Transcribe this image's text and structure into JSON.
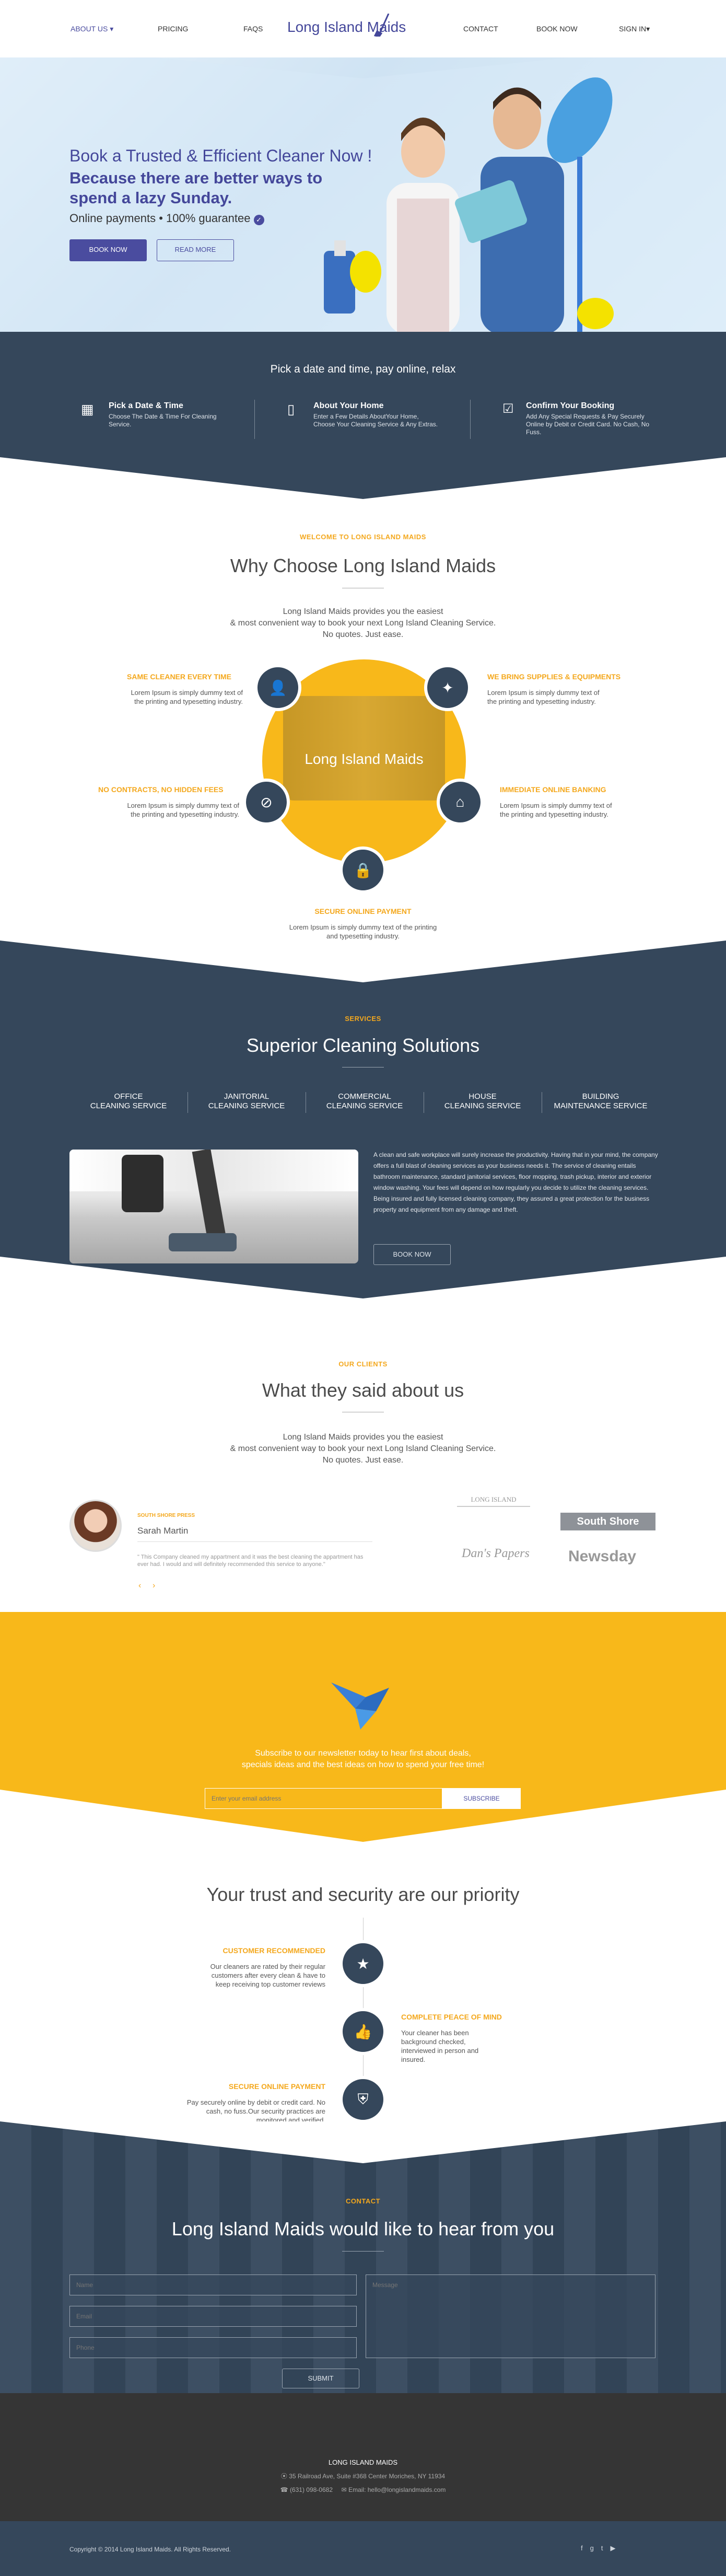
{
  "nav": {
    "about": "ABOUT US",
    "pricing": "PRICING",
    "faqs": "FAQS",
    "logo": "Long Island Maids",
    "contact": "CONTACT",
    "book": "BOOK NOW",
    "signin": "SIGN IN"
  },
  "hero": {
    "line1": "Book a Trusted & Efficient Cleaner Now !",
    "line2": "Because there are better ways to spend a lazy Sunday.",
    "line3": "Online payments • 100% guarantee",
    "book_btn": "BOOK NOW",
    "read_btn": "READ MORE"
  },
  "steps": {
    "heading": "Pick a date and time, pay online, relax",
    "items": [
      {
        "title": "Pick a Date & Time",
        "text": "Choose The Date & Time For Cleaning Service."
      },
      {
        "title": "About Your Home",
        "text": "Enter a Few Details AboutYour Home, Choose Your Cleaning Service & Any Extras."
      },
      {
        "title": "Confirm Your Booking",
        "text": "Add Any Special Requests & Pay Securely Online by Debit or Credit Card. No Cash, No Fuss."
      }
    ]
  },
  "why": {
    "label": "WELCOME TO LONG ISLAND MAIDS",
    "title": "Why Choose Long Island Maids",
    "sub1": "Long Island Maids provides you the easiest",
    "sub2": "& most convenient way to book your next Long Island Cleaning Service.",
    "sub3": "No quotes. Just ease.",
    "center_logo": "Long Island Maids",
    "features": [
      {
        "title": "SAME CLEANER EVERY TIME",
        "text": "Lorem Ipsum is simply dummy text of the printing and typesetting industry."
      },
      {
        "title": "WE BRING SUPPLIES & EQUIPMENTS",
        "text": "Lorem Ipsum is simply dummy text of the printing and typesetting industry."
      },
      {
        "title": "NO CONTRACTS, NO HIDDEN FEES",
        "text": "Lorem Ipsum is simply dummy text of the printing and typesetting industry."
      },
      {
        "title": "IMMEDIATE ONLINE BANKING",
        "text": "Lorem Ipsum is simply dummy text of the printing and typesetting industry."
      },
      {
        "title": "SECURE ONLINE PAYMENT",
        "text": "Lorem Ipsum is simply dummy text of the printing and typesetting industry."
      }
    ]
  },
  "services": {
    "label": "SERVICES",
    "title": "Superior Cleaning Solutions",
    "tabs": [
      [
        "OFFICE",
        "CLEANING SERVICE"
      ],
      [
        "JANITORIAL",
        "CLEANING SERVICE"
      ],
      [
        "COMMERCIAL",
        "CLEANING SERVICE"
      ],
      [
        "HOUSE",
        "CLEANING SERVICE"
      ],
      [
        "BUILDING",
        "MAINTENANCE SERVICE"
      ]
    ],
    "text": "A clean and safe workplace will surely increase the productivity. Having that in your mind, the company offers a full blast of cleaning services as your business needs it. The service of cleaning entails bathroom maintenance, standard janitorial services, floor mopping, trash pickup, interior and exterior window washing. Your fees will depend on how regularly you decide to utilize the cleaning services. Being insured and fully licensed cleaning company, they assured a great protection for the business property and equipment from any damage and theft.",
    "btn": "BOOK NOW"
  },
  "clients": {
    "label": "OUR CLIENTS",
    "title": "What they said about us",
    "sub1": "Long Island Maids provides you the easiest",
    "sub2": "& most convenient way to book your next Long Island Cleaning Service.",
    "sub3": "No quotes. Just ease.",
    "source": "SOUTH SHORE PRESS",
    "name": "Sarah Martin",
    "quote": "\" This Company cleaned my appartment and it was the best cleaning the appartment has ever had. I would and will definitely recommended this service to anyone.\"",
    "logos": [
      "LONG ISLAND",
      "South Shore",
      "Dan's Papers",
      "Newsday"
    ]
  },
  "newsletter": {
    "text1": "Subscribe to our newsletter today to hear first about deals,",
    "text2": "specials ideas and the best ideas on how to spend your free time!",
    "placeholder": "Enter your email address",
    "btn": "SUBSCRIBE"
  },
  "trust": {
    "title": "Your trust and security are our priority",
    "items": [
      {
        "title": "CUSTOMER RECOMMENDED",
        "text": "Our cleaners are rated by their regular customers after every clean & have to keep receiving top customer reviews"
      },
      {
        "title": "COMPLETE PEACE OF MIND",
        "text": "Your cleaner has been background checked, interviewed in person and insured."
      },
      {
        "title": "SECURE ONLINE PAYMENT",
        "text": "Pay securely online by debit or credit card. No cash, no fuss.Our security practices are monitored and verified."
      }
    ]
  },
  "contact": {
    "label": "CONTACT",
    "title": "Long Island Maids would like to hear from you",
    "name": "Name",
    "email": "Email",
    "phone": "Phone",
    "message": "Message",
    "btn": "SUBMIT"
  },
  "footer": {
    "title": "LONG ISLAND MAIDS",
    "address": "35 Railroad Ave, Suite #368 Center Moriches, NY 11934",
    "phone": "(631) 098-0682",
    "email": "Email: hello@longislandmaids.com",
    "copyright": "Copyright © 2014 Long Island Maids. All Rights Reserved."
  },
  "colors": {
    "navy": "#35475b",
    "purple": "#4a4c9f",
    "orange": "#f4a81d",
    "yellow": "#f8b81a"
  }
}
